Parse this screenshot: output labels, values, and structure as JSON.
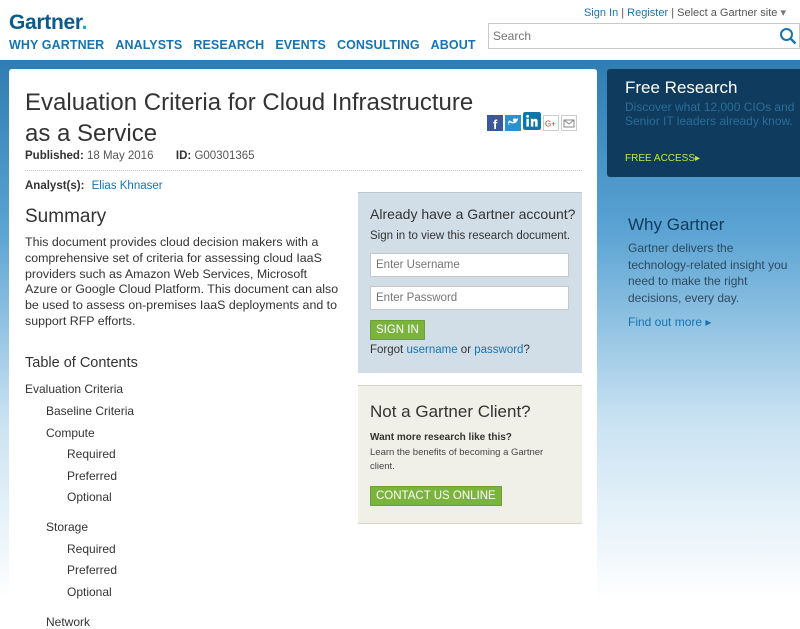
{
  "header": {
    "logo": "Gartner",
    "logo_dot": ".",
    "nav": [
      "WHY GARTNER",
      "ANALYSTS",
      "RESEARCH",
      "EVENTS",
      "CONSULTING",
      "ABOUT"
    ],
    "sign_in": "Sign In",
    "separator": "|",
    "register": "Register",
    "site_select": "Select a Gartner site",
    "site_select_arrow": "▾",
    "search_placeholder": "Search"
  },
  "doc": {
    "title": "Evaluation Criteria for Cloud Infrastructure as a Service",
    "published_label": "Published:",
    "published_value": "18 May 2016",
    "id_label": "ID:",
    "id_value": "G00301365",
    "analyst_label": "Analyst(s):",
    "analyst_name": "Elias Khnaser",
    "summary_heading": "Summary",
    "summary_text": "This document provides cloud decision makers with a comprehensive set of criteria for assessing cloud IaaS providers such as Amazon Web Services, Microsoft Azure or Google Cloud Platform. This document can also be used to assess on-premises IaaS deployments and to support RFP efforts.",
    "toc_heading": "Table of Contents",
    "toc": [
      {
        "label": "Evaluation Criteria",
        "level": 0
      },
      {
        "label": "Baseline Criteria",
        "level": 1
      },
      {
        "label": "Compute",
        "level": 1
      },
      {
        "label": "Required",
        "level": 2
      },
      {
        "label": "Preferred",
        "level": 2
      },
      {
        "label": "Optional",
        "level": 2
      },
      {
        "label": "Storage",
        "level": 1
      },
      {
        "label": "Required",
        "level": 2
      },
      {
        "label": "Preferred",
        "level": 2
      },
      {
        "label": "Optional",
        "level": 2
      },
      {
        "label": "Network",
        "level": 1
      }
    ],
    "social": {
      "facebook": "f",
      "google": "G+"
    }
  },
  "login": {
    "heading": "Already have a Gartner account?",
    "subtext": "Sign in to view this research document.",
    "username_placeholder": "Enter Username",
    "password_placeholder": "Enter Password",
    "signin_button": "SIGN IN",
    "forgot_prefix": "Forgot",
    "forgot_username": "username",
    "forgot_or": "or",
    "forgot_password": "password",
    "forgot_suffix": "?"
  },
  "client": {
    "heading": "Not a Gartner Client?",
    "question": "Want more research like this?",
    "description": "Learn the benefits of becoming a Gartner client.",
    "contact_button": "CONTACT US ONLINE"
  },
  "free_research": {
    "heading": "Free Research",
    "description": "Discover what 12,000 CIOs and Senior IT leaders already know.",
    "cta": "FREE ACCESS",
    "cta_arrow": "▸"
  },
  "why_gartner": {
    "heading": "Why Gartner",
    "description": "Gartner delivers the technology-related insight you need to make the right decisions, every day.",
    "more": "Find out more",
    "more_arrow": "▸"
  },
  "colors": {
    "brand_blue": "#1674b3",
    "dark_navy": "#0f3b5e",
    "green": "#7ab43c"
  }
}
